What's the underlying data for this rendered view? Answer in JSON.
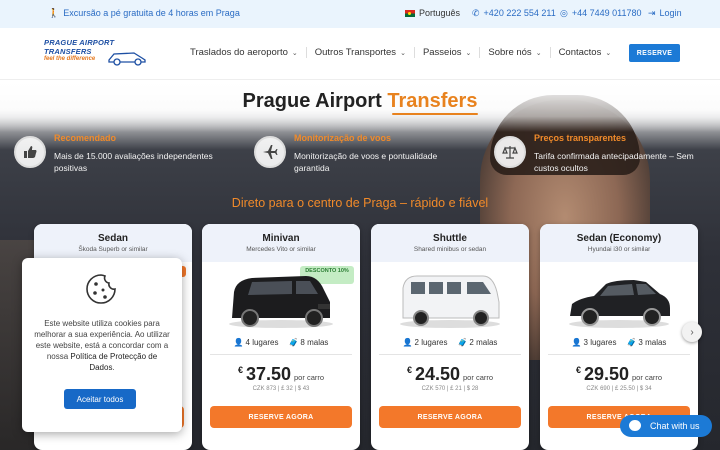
{
  "topbar": {
    "promo": "Excursão a pé gratuita de 4 horas em Praga",
    "language": "Português",
    "phone1": "+420 222 554 211",
    "phone2": "+44 7449 011780",
    "login": "Login"
  },
  "logo": {
    "line1": "PRAGUE AIRPORT TRANSFERS",
    "line2": "feel the difference"
  },
  "nav": {
    "items": [
      {
        "label": "Traslados do aeroporto"
      },
      {
        "label": "Outros Transportes"
      },
      {
        "label": "Passeios"
      },
      {
        "label": "Sobre nós"
      },
      {
        "label": "Contactos"
      }
    ],
    "reserve": "RESERVE"
  },
  "hero": {
    "title_main": "Prague Airport ",
    "title_accent": "Transfers",
    "features": [
      {
        "title": "Recomendado",
        "desc": "Mais de 15.000 avaliações independentes positivas",
        "icon": "thumbs-up-icon"
      },
      {
        "title": "Monitorização de voos",
        "desc": "Monitorização de voos e pontualidade garantida",
        "icon": "plane-icon"
      },
      {
        "title": "Preços transparentes",
        "desc": "Tarifa confirmada antecipadamente – Sem custos ocultos",
        "icon": "scales-icon"
      }
    ],
    "subhead": "Direto para o centro de Praga – rápido e fiável"
  },
  "cards": [
    {
      "name": "Sedan",
      "model": "Škoda Superb or similar",
      "passengers": "",
      "bags": "",
      "currency": "",
      "price": "",
      "per": "",
      "alt": "",
      "button": ""
    },
    {
      "name": "Minivan",
      "model": "Mercedes Vito or similar",
      "discount": "DESCONTO 10%",
      "passengers": "4 lugares",
      "bags": "8 malas",
      "currency": "€",
      "price": "37.50",
      "per": "por carro",
      "alt": "CZK 873 | £ 32 | $ 43",
      "button": "RESERVE AGORA"
    },
    {
      "name": "Shuttle",
      "model": "Shared minibus or sedan",
      "passengers": "2 lugares",
      "bags": "2 malas",
      "currency": "€",
      "price": "24.50",
      "per": "por carro",
      "alt": "CZK 570 | £ 21 | $ 28",
      "button": "RESERVE AGORA"
    },
    {
      "name": "Sedan (Economy)",
      "model": "Hyundai i30 or similar",
      "passengers": "3 lugares",
      "bags": "3 malas",
      "currency": "€",
      "price": "29.50",
      "per": "por carro",
      "alt": "CZK 690 | £ 25.50 | $ 34",
      "button": "RESERVE AGORA"
    }
  ],
  "cookie": {
    "text": "Este website utiliza cookies para melhorar a sua experiência. Ao utilizar este website, está a concordar com a nossa ",
    "link": "Política de Protecção de Dados",
    "end": ".",
    "button": "Aceitar todos"
  },
  "chat": {
    "label": "Chat with us"
  },
  "colors": {
    "accent": "#e8821e",
    "brand_blue": "#1c7ad6",
    "button_orange": "#f3782a"
  }
}
